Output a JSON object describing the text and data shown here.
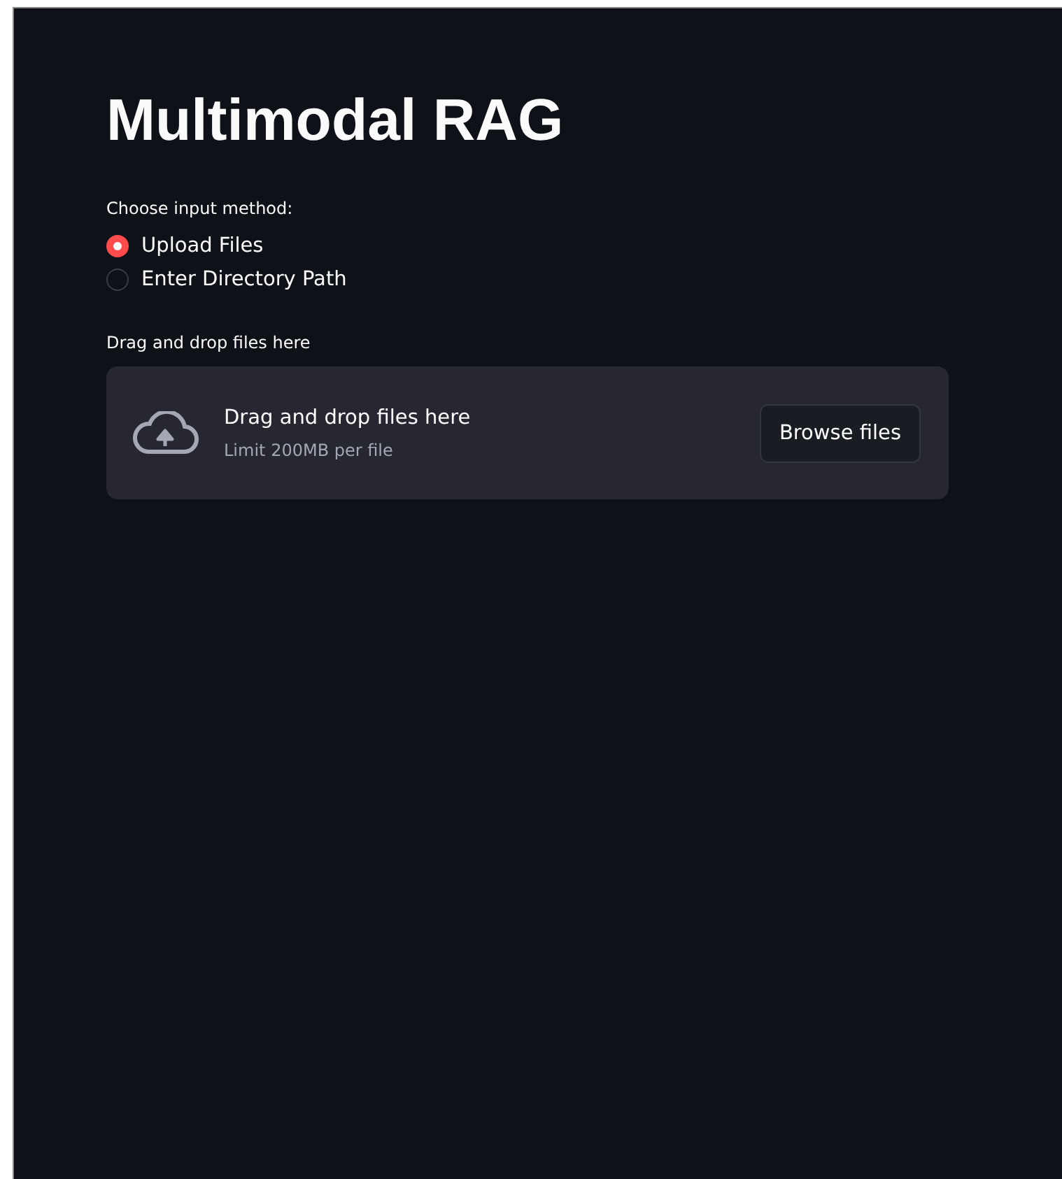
{
  "title": "Multimodal RAG",
  "input_method": {
    "label": "Choose input method:",
    "options": [
      {
        "label": "Upload Files",
        "selected": true
      },
      {
        "label": "Enter Directory Path",
        "selected": false
      }
    ]
  },
  "uploader": {
    "label": "Drag and drop files here",
    "instruction": "Drag and drop files here",
    "limit": "Limit 200MB per file",
    "button": "Browse files"
  }
}
